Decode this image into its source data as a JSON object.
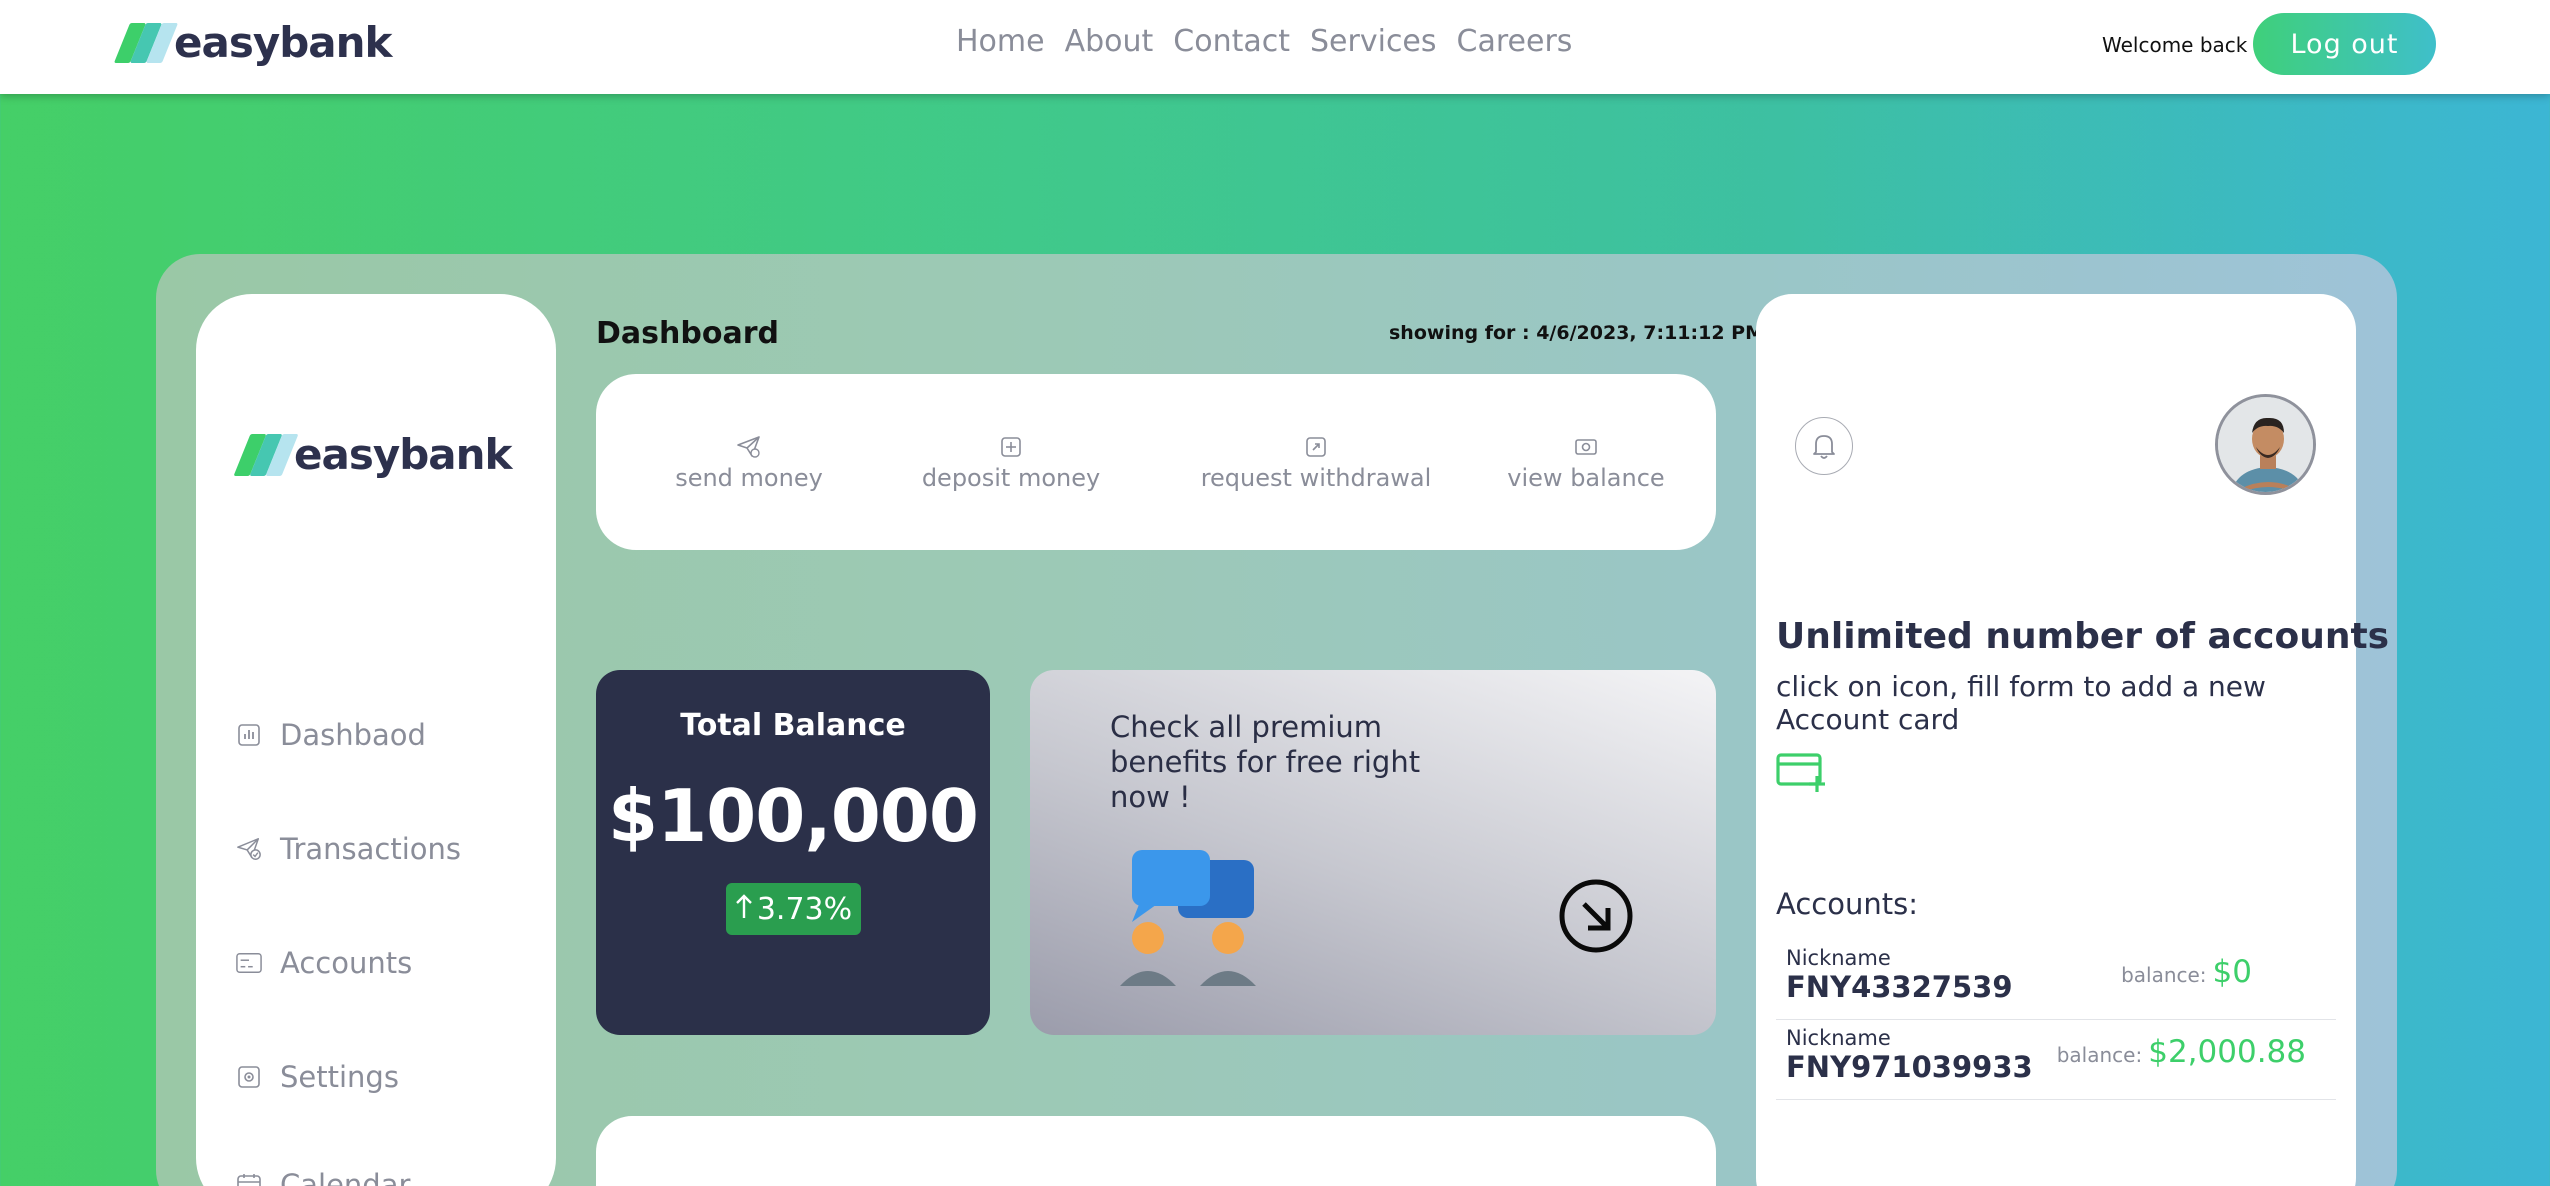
{
  "brand": {
    "name": "easybank",
    "colors": {
      "accent": "#3dcf6a",
      "dark": "#2b3049",
      "teal": "#3fbfca"
    }
  },
  "nav": {
    "items": [
      "Home",
      "About",
      "Contact",
      "Services",
      "Careers"
    ]
  },
  "header": {
    "welcome": "Welcome back :",
    "logout": "Log out"
  },
  "sidebar": {
    "items": [
      {
        "label": "Dashbaod",
        "icon": "bar-chart-icon"
      },
      {
        "label": "Transactions",
        "icon": "send-check-icon"
      },
      {
        "label": "Accounts",
        "icon": "card-icon"
      },
      {
        "label": "Settings",
        "icon": "gear-icon"
      },
      {
        "label": "Calendar",
        "icon": "calendar-icon"
      }
    ]
  },
  "dashboard": {
    "title": "Dashboard",
    "showing_for": "showing for : 4/6/2023, 7:11:12 PM",
    "actions": [
      {
        "label": "send money",
        "icon": "send-icon"
      },
      {
        "label": "deposit money",
        "icon": "plus-square-icon"
      },
      {
        "label": "request withdrawal",
        "icon": "withdraw-icon"
      },
      {
        "label": "view balance",
        "icon": "cash-icon"
      }
    ],
    "balance": {
      "title": "Total Balance",
      "value": "$100,000",
      "change": "3.73%",
      "change_icon": "arrow-up-icon"
    },
    "premium": {
      "text": "Check all premium benefits for free right now !",
      "icon": "arrow-down-right-circle-icon"
    }
  },
  "right": {
    "bell_icon": "bell-icon",
    "headline": "Unlimited number of accounts",
    "hint": "click on icon, fill form to add a new Account card",
    "add_icon": "card-plus-icon",
    "accounts_heading": "Accounts:",
    "accounts": [
      {
        "nickname_label": "Nickname",
        "number": "FNY43327539",
        "balance_label": "balance:",
        "balance": "$0"
      },
      {
        "nickname_label": "Nickname",
        "number": "FNY971039933",
        "balance_label": "balance:",
        "balance": "$2,000.88"
      }
    ]
  }
}
